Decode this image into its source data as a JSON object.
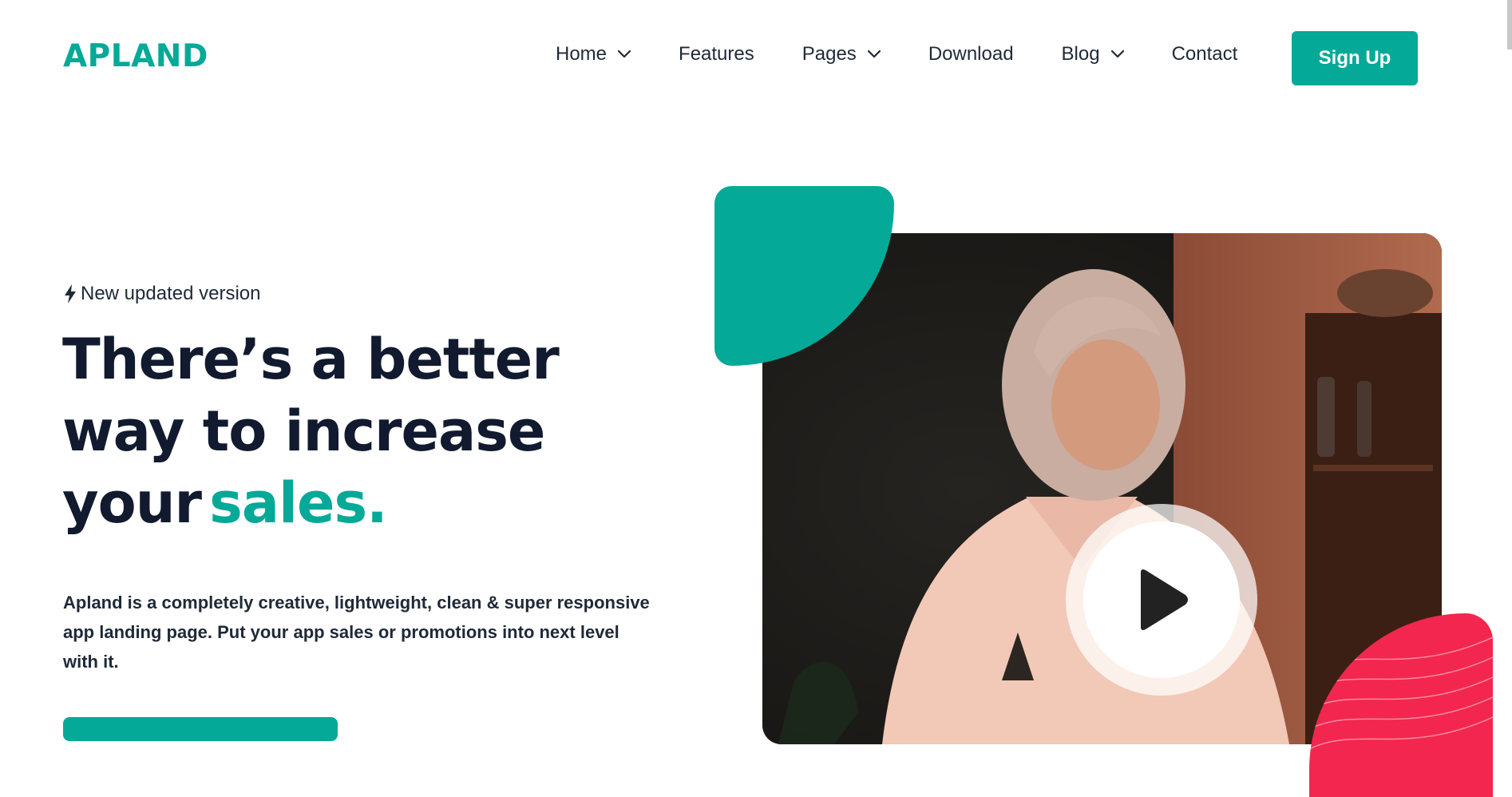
{
  "brand": {
    "logo_text": "APLAND",
    "accent": "#05a997",
    "pink": "#f2264f"
  },
  "nav": {
    "items": [
      {
        "label": "Home",
        "has_dropdown": true
      },
      {
        "label": "Features",
        "has_dropdown": false
      },
      {
        "label": "Pages",
        "has_dropdown": true
      },
      {
        "label": "Download",
        "has_dropdown": false
      },
      {
        "label": "Blog",
        "has_dropdown": true
      },
      {
        "label": "Contact",
        "has_dropdown": false
      }
    ],
    "signup_label": "Sign Up"
  },
  "hero": {
    "badge": {
      "icon": "bolt-icon",
      "text": "New updated version"
    },
    "headline": {
      "line1": "There’s a better",
      "line2": "way to increase",
      "line3": "your",
      "accent": "sales."
    },
    "lead": "Apland is a completely creative, lightweight, clean & super responsive app landing page. Put your app sales or promotions into next level with it.",
    "video": {
      "icon": "play-icon"
    }
  }
}
